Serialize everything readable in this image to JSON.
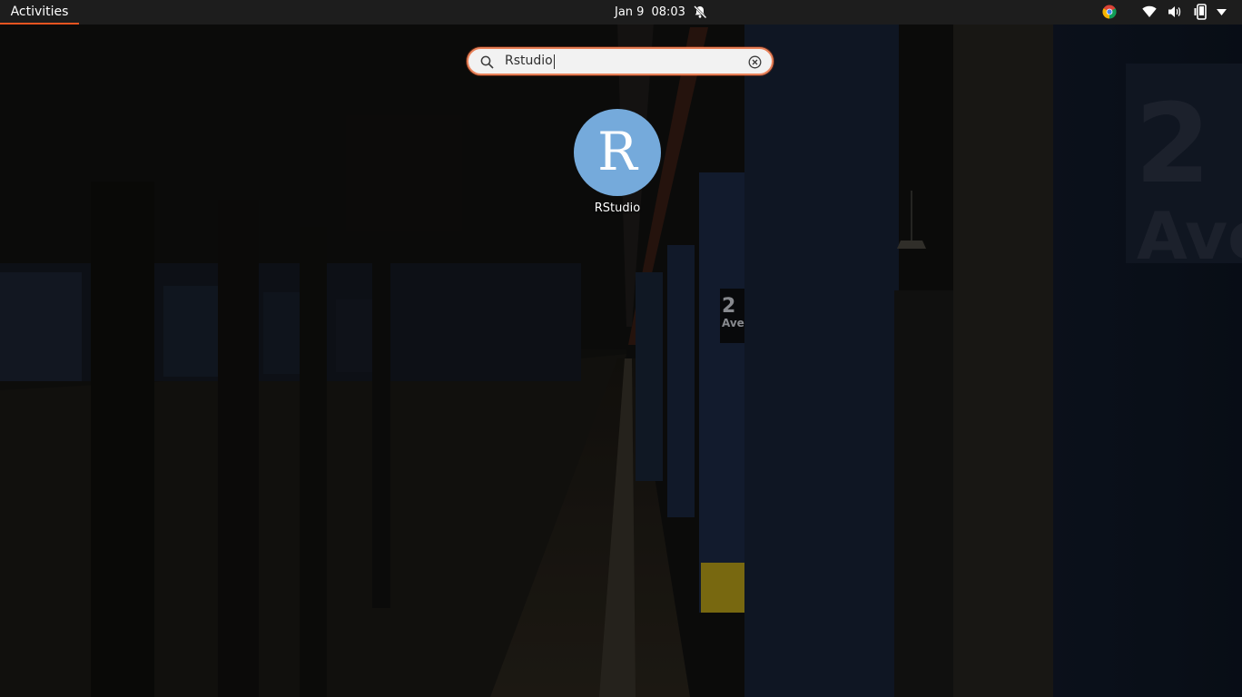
{
  "topbar": {
    "activities_label": "Activities",
    "date": "Jan 9",
    "time": "08:03",
    "icons": {
      "notifications": "notifications-disabled-icon",
      "chrome": "chrome-icon",
      "wifi": "wifi-icon",
      "volume": "volume-icon",
      "rotation": "screen-rotation-icon",
      "menu": "system-menu-arrow-icon"
    }
  },
  "search": {
    "value": "Rstudio",
    "icon": "search-icon",
    "clear_icon": "clear-icon"
  },
  "results": [
    {
      "label": "RStudio",
      "icon_letter": "R",
      "icon_color": "#75aadb"
    }
  ],
  "colors": {
    "accent": "#e95420",
    "topbar": "#1d1d1d",
    "search_bg": "#f2f2f2"
  },
  "wallpaper": {
    "sign_number": "2",
    "sign_text": "Ave"
  }
}
